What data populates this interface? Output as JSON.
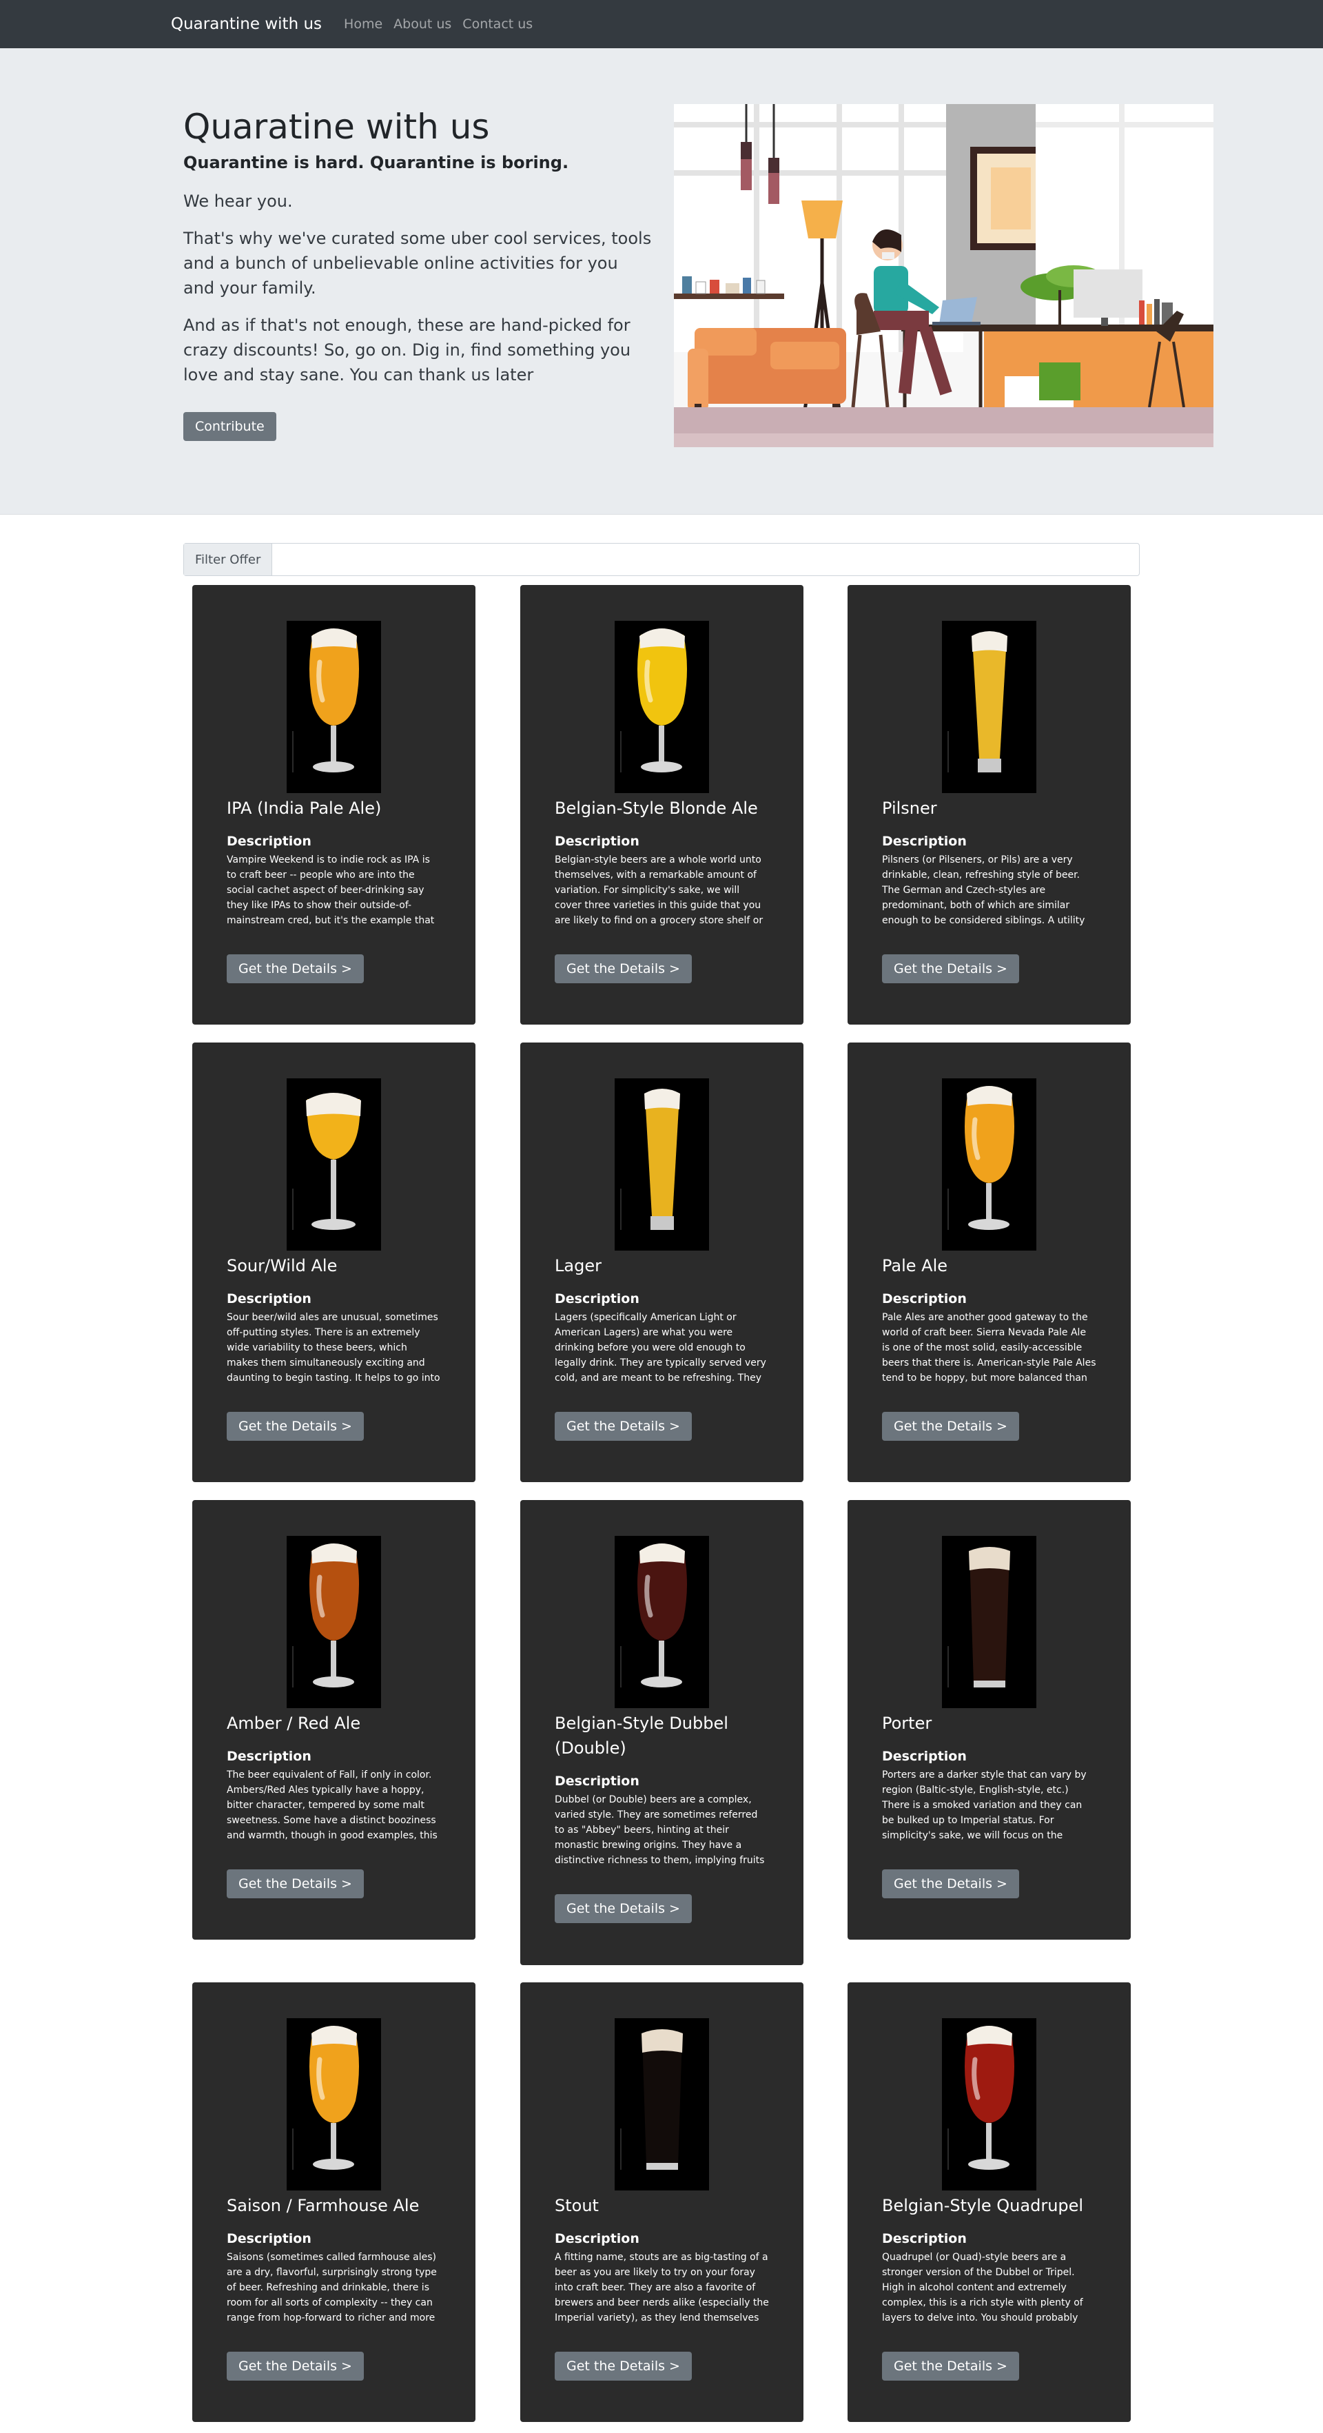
{
  "navbar": {
    "brand": "Quarantine with us",
    "links": [
      "Home",
      "About us",
      "Contact us"
    ]
  },
  "hero": {
    "title": "Quaratine with us",
    "subtitle": "Quarantine is hard. Quarantine is boring.",
    "paragraphs": [
      "We hear you.",
      "That's why we've curated some uber cool services, tools and a bunch of unbelievable online activities for you and your family.",
      "And as if that's not enough, these are hand-picked for crazy discounts! So, go on. Dig in, find something you love and stay sane. You can thank us later"
    ],
    "button": "Contribute"
  },
  "filter": {
    "label": "Filter Offer",
    "value": ""
  },
  "cards": [
    {
      "title": "IPA (India Pale Ale)",
      "description_label": "Description",
      "text": "Vampire Weekend is to indie rock as IPA is to craft beer -- people who are into the social cachet aspect of beer-drinking say they like IPAs to show their outside-of-mainstream cred, but it's the example that everyone uses,",
      "button": "Get the Details >",
      "beer_color": "#f0a21c",
      "glass": "tulip"
    },
    {
      "title": "Belgian-Style Blonde Ale",
      "description_label": "Description",
      "text": "Belgian-style beers are a whole world unto themselves, with a remarkable amount of variation. For simplicity's sake, we will cover three varieties in this guide that you are likely to find on a grocery store shelf or in a bar",
      "button": "Get the Details >",
      "beer_color": "#f1c40f",
      "glass": "tulip"
    },
    {
      "title": "Pilsner",
      "description_label": "Description",
      "text": "Pilsners (or Pilseners, or Pils) are a very drinkable, clean, refreshing style of beer. The German and Czech-styles are predominant, both of which are similar enough to be considered siblings. A utility beer, they are",
      "button": "Get the Details >",
      "beer_color": "#e9b82a",
      "glass": "pilsner"
    },
    {
      "title": "Sour/Wild Ale",
      "description_label": "Description",
      "text": "Sour beer/wild ales are unusual, sometimes off-putting styles. There is an extremely wide variability to these beers, which makes them simultaneously exciting and daunting to begin tasting. It helps to go into trying sour beers",
      "button": "Get the Details >",
      "beer_color": "#f2b21a",
      "glass": "goblet"
    },
    {
      "title": "Lager",
      "description_label": "Description",
      "text": "Lagers (specifically American Light or American Lagers) are what you were drinking before you were old enough to legally drink. They are typically served very cold, and are meant to be refreshing. They aren't technically",
      "button": "Get the Details >",
      "beer_color": "#e8b21f",
      "glass": "pilsner"
    },
    {
      "title": "Pale Ale",
      "description_label": "Description",
      "text": "Pale Ales are another good gateway to the world of craft beer. Sierra Nevada Pale Ale is one of the most solid, easily-accessible beers that there is. American-style Pale Ales tend to be hoppy, but more balanced than an IPA, and",
      "button": "Get the Details >",
      "beer_color": "#f0a21c",
      "glass": "tulip"
    },
    {
      "title": "Amber / Red Ale",
      "description_label": "Description",
      "text": "The beer equivalent of Fall, if only in color. Ambers/Red Ales typically have a hoppy, bitter character, tempered by some malt sweetness. Some have a distinct booziness and warmth, though in good examples, this is never",
      "button": "Get the Details >",
      "beer_color": "#b5500f",
      "glass": "tulip"
    },
    {
      "title": "Belgian-Style Dubbel (Double)",
      "description_label": "Description",
      "text": "Dubbel (or Double) beers are a complex, varied style. They are sometimes referred to as \"Abbey\" beers, hinting at their monastic brewing origins. They have a distinctive richness to them, implying fruits like raisins,",
      "button": "Get the Details >",
      "beer_color": "#4a1410",
      "glass": "tulip"
    },
    {
      "title": "Porter",
      "description_label": "Description",
      "text": "Porters are a darker style that can vary by region (Baltic-style, English-style, etc.) There is a smoked variation and they can be bulked up to Imperial status. For simplicity's sake, we will focus on the American-style porters here. Like",
      "button": "Get the Details >",
      "beer_color": "#2a140e",
      "glass": "pint"
    },
    {
      "title": "Saison / Farmhouse Ale",
      "description_label": "Description",
      "text": "Saisons (sometimes called farmhouse ales) are a dry, flavorful, surprisingly strong type of beer. Refreshing and drinkable, there is room for all sorts of complexity -- they can range from hop-forward to richer and more malty, to",
      "button": "Get the Details >",
      "beer_color": "#f0a21c",
      "glass": "tulip"
    },
    {
      "title": "Stout",
      "description_label": "Description",
      "text": "A fitting name, stouts are as big-tasting of a beer as you are likely to try on your foray into craft beer. They are also a favorite of brewers and beer nerds alike (especially the Imperial variety), as they lend themselves well to",
      "button": "Get the Details >",
      "beer_color": "#120c0a",
      "glass": "pint"
    },
    {
      "title": "Belgian-Style Quadrupel",
      "description_label": "Description",
      "text": "Quadrupel (or Quad)-style beers are a stronger version of the Dubbel or Tripel. High in alcohol content and extremely complex, this is a rich style with plenty of layers to delve into. You should probably not drink a bomber",
      "button": "Get the Details >",
      "beer_color": "#9e1a10",
      "glass": "tulip"
    }
  ]
}
